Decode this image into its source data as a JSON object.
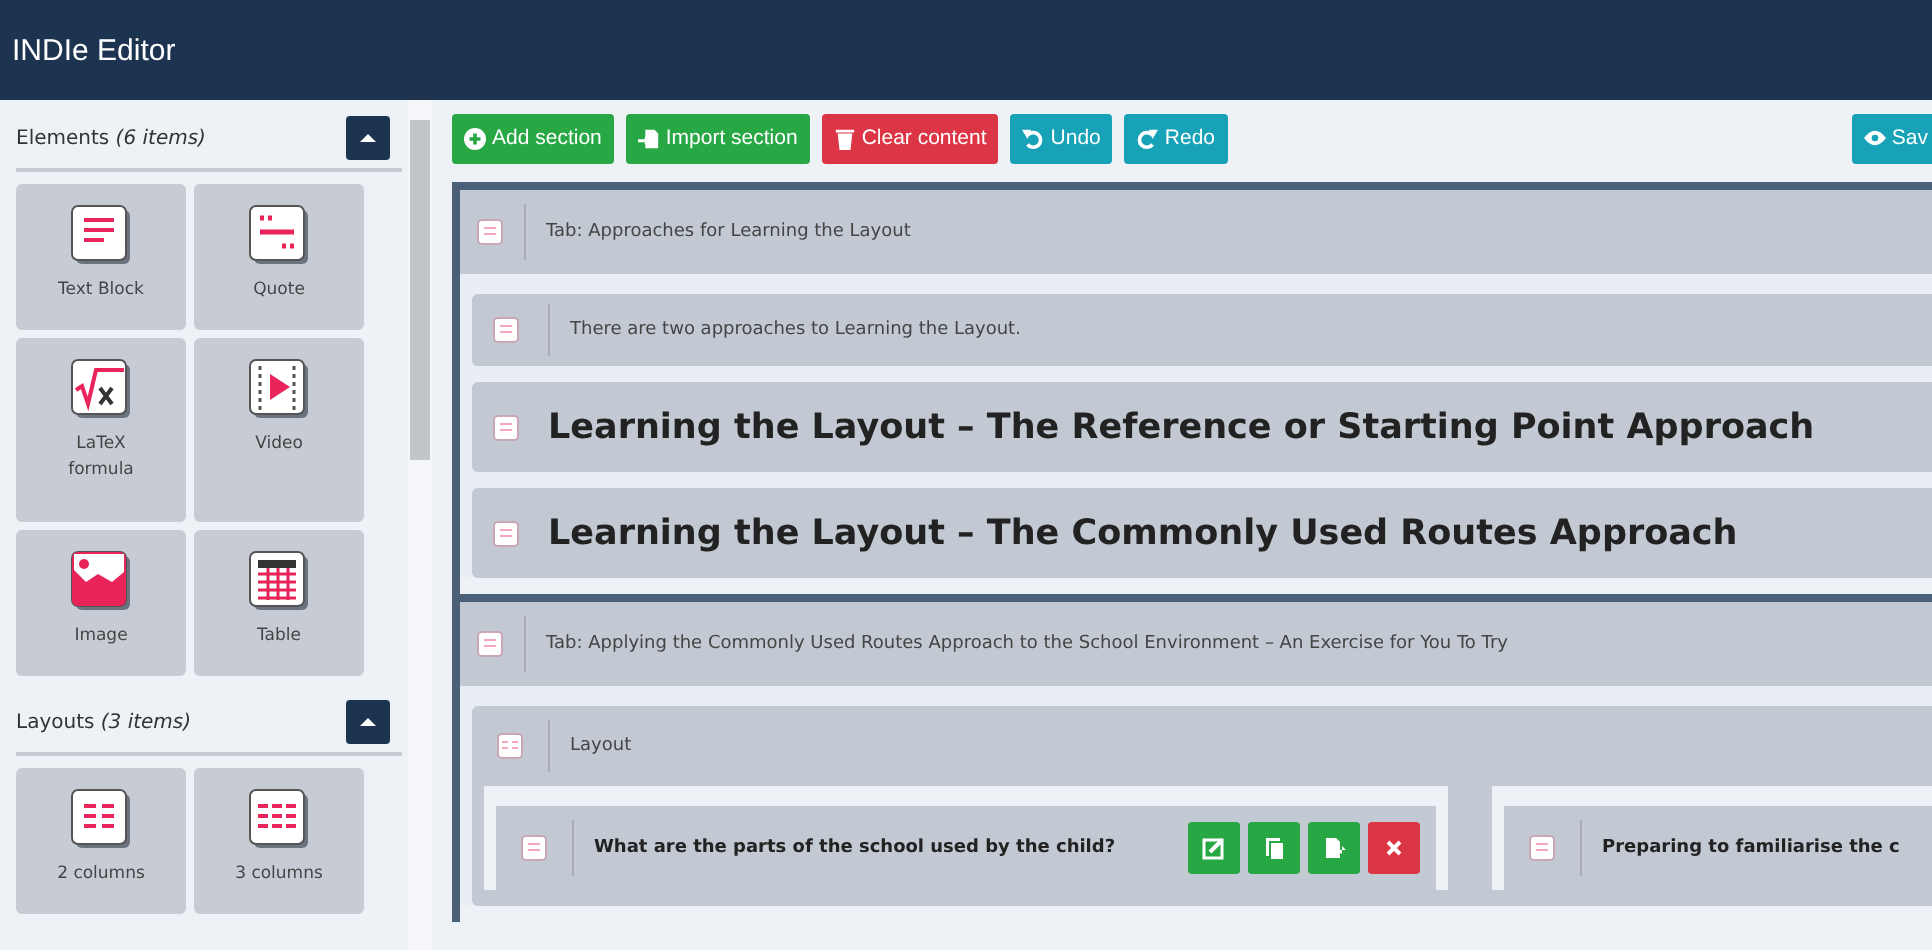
{
  "window": {
    "title": "INDIe Editor"
  },
  "sidebar": {
    "groups": [
      {
        "title": "Elements *(6 items)*",
        "expanded": true,
        "items": [
          {
            "label": "Text Block",
            "kind": "text"
          },
          {
            "label": "Quote",
            "kind": "quote"
          },
          {
            "label": "LaTeX formula",
            "kind": "latex"
          },
          {
            "label": "Video",
            "kind": "video"
          },
          {
            "label": "Image",
            "kind": "image"
          },
          {
            "label": "Table",
            "kind": "table"
          }
        ]
      },
      {
        "title": "Layouts *(3 items)*",
        "expanded": true,
        "items": [
          {
            "label": "2 columns",
            "kind": "columns2"
          },
          {
            "label": "3 columns",
            "kind": "columns3"
          }
        ]
      }
    ]
  },
  "toolbar": {
    "buttons": [
      {
        "label": "Add section",
        "kind": "add"
      },
      {
        "label": "Import section",
        "kind": "import"
      },
      {
        "label": "Clear content",
        "kind": "clear"
      },
      {
        "label": "Undo",
        "kind": "undo"
      },
      {
        "label": "Redo",
        "kind": "redo"
      }
    ],
    "save": {
      "label": "Sav"
    }
  },
  "sections": [
    {
      "title": "Tab: Approaches for Learning the Layout",
      "blocks": [
        {
          "kind": "text",
          "text": "There are two approaches to Learning the Layout."
        },
        {
          "kind": "heading",
          "text": "Learning the Layout – The Reference or Starting Point Approach"
        },
        {
          "kind": "heading",
          "text": "Learning the Layout – The Commonly Used Routes Approach"
        }
      ]
    },
    {
      "title": "Tab: Applying the Commonly Used Routes Approach to the School Environment – An Exercise for You To Try",
      "blocks": [
        {
          "kind": "layout",
          "text": "Layout",
          "columns": [
            {
              "text": "What are the parts of the school used by the child?",
              "actions": true
            },
            {
              "text": "Preparing to familiarise the c"
            }
          ]
        }
      ]
    }
  ]
}
